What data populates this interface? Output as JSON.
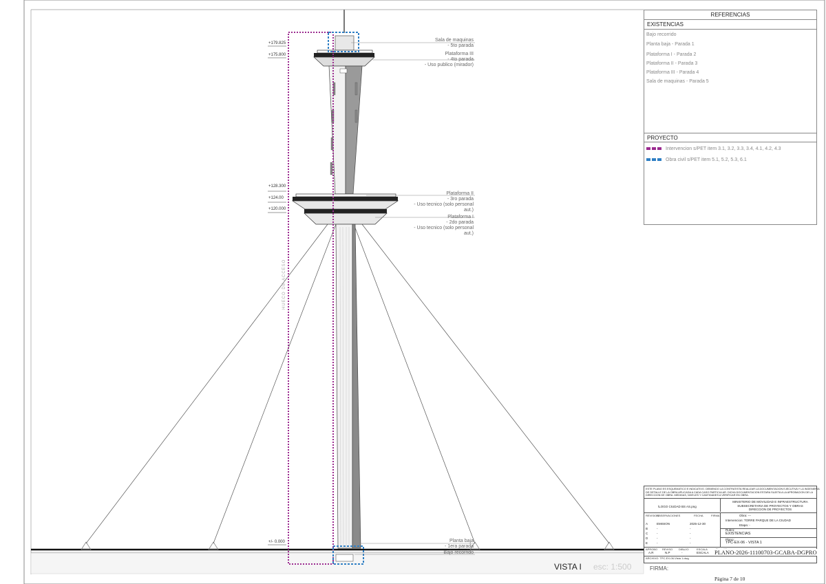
{
  "levels": [
    "+179.825",
    "+175.800",
    "+128.300",
    "+124.00",
    "+120.000",
    "+/- 0.000"
  ],
  "callouts": {
    "sala_maquinas": [
      "Sala de maquinas",
      "- 5to parada"
    ],
    "plataforma3": [
      "Plataforma III",
      "- 4to parada",
      "- Uso publico (mirador)"
    ],
    "plataforma2": [
      "Plataforma II",
      "- 3ro parada",
      "- Uso tecnico (solo personal",
      "aut.)"
    ],
    "plataforma1": [
      "Plataforma I",
      "- 2do parada",
      "- Uso tecnico (solo personal",
      "aut.)"
    ],
    "planta_baja": [
      "Planta baja",
      "- 1era parada"
    ],
    "bajo_recorrido": "Bajo recorrido"
  },
  "shaft_label": "HUECO DE ACCESO",
  "references": {
    "title": "REFERENCIAS",
    "existencias_title": "EXISTENCIAS",
    "existencias": [
      "Bajo recorrido",
      "Planta baja - Parada 1",
      "Plataforma I - Parada 2",
      "Plataforma II - Parada 3",
      "Plataforma III - Parada 4",
      "Sala de maquinas - Parada 5"
    ],
    "proyecto_title": "PROYECTO",
    "proyecto": [
      {
        "label": "Intervencion s/PET item 3.1, 3.2, 3.3, 3.4, 4.1, 4.2, 4.3",
        "color": "#9b2a8f"
      },
      {
        "label": "Obra civil s/PET item 5.1, 5.2, 5.3, 6.1",
        "color": "#2f7fc4"
      }
    ]
  },
  "title_block": {
    "disclaimer": [
      "ESTE PLANO ES ESQUEMATICO E INDICATIVO. DEBIENDO LA CONTRATISTA REALIZAR LA DOCUMENTACION EJECUTIVA Y LA INGENIERIA",
      "DE DETALLE DE LA OBRA APLICADA A CADA CASO PARTICULAR. DICHA DOCUMENTACION ESTARA SUJETA A LA APROBACION DE LA",
      "DIRECCION DE OBRA. MEDIDAS, NIVELES Y CANTIDADES A VERIFICAR EN OBRA."
    ],
    "logo": "\\LOGO CIUDAD BS AS.png",
    "ministry": [
      "MINISTERIO DE MOVILIDAD E INFRAESTRUCTURA",
      "SUBSECRETARIA DE PROYECTOS Y OBRAS",
      "DIRECCION DE PROYECTOS"
    ],
    "rev_headers": [
      "REVISION",
      "OBSERVACIONES",
      "FECHA",
      "FIRMA"
    ],
    "revisions": [
      [
        "A",
        "EMISION",
        "2025-12-30"
      ],
      [
        "B",
        "-",
        "-"
      ],
      [
        "C",
        "-",
        "-"
      ],
      [
        "D",
        "-",
        "-"
      ],
      [
        "E",
        "-",
        "-"
      ]
    ],
    "obra_label": "Obra:",
    "obra_value": "---",
    "intervencion_label": "Intervencion:",
    "intervencion_value": "TORRE PARQUE DE LA CIUDAD",
    "etapa_label": "Etapa:",
    "etapa_value": "-",
    "rubro_label": "Rubro:",
    "rubro_value": "EXISTENCIAS",
    "plano_label": "Plano:",
    "plano_value": "TPC-EX-06 - VISTA 1",
    "row_labels": [
      "APROBO",
      "REVISO",
      "DIBUJO",
      "ESCALA"
    ],
    "row_values": [
      "A.R",
      "N.P",
      "-",
      "ESCALA"
    ],
    "plano_num_label": "Plano N°",
    "archivo": "ARCHIVO: TPC-EX-06-Vista 1.dwg",
    "plano_id": "PLANO-2026-11100703-GCABA-DGPRO",
    "pagina": "Página 7 de 10"
  },
  "view_title": "VISTA I",
  "scale": "esc: 1:500",
  "firma": "FIRMA:"
}
